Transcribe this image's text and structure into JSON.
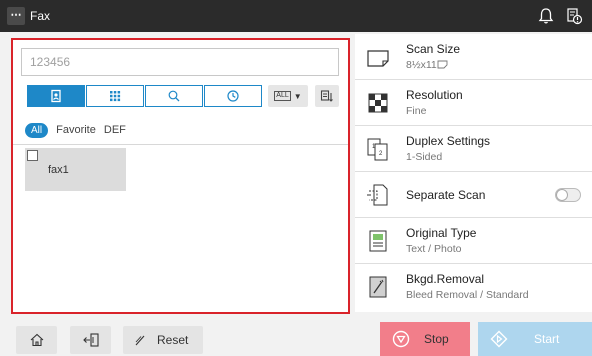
{
  "header": {
    "menu_label": "⋯",
    "title": "Fax"
  },
  "address": {
    "number_value": "123456",
    "dropdown_label": "ALL",
    "filters": [
      "All",
      "Favorite",
      "DEF"
    ],
    "entries": [
      {
        "name": "fax1",
        "checked": false
      }
    ]
  },
  "settings": [
    {
      "label": "Scan Size",
      "value": "8½x11",
      "icon": "scan-size-icon"
    },
    {
      "label": "Resolution",
      "value": "Fine",
      "icon": "resolution-icon"
    },
    {
      "label": "Duplex Settings",
      "value": "1-Sided",
      "icon": "duplex-icon"
    },
    {
      "label": "Separate Scan",
      "value": "",
      "icon": "separate-scan-icon",
      "toggle": false
    },
    {
      "label": "Original Type",
      "value": "Text / Photo",
      "icon": "original-type-icon"
    },
    {
      "label": "Bkgd.Removal",
      "value": "Bleed Removal / Standard",
      "icon": "bkgd-removal-icon"
    }
  ],
  "footer": {
    "reset_label": "Reset",
    "stop_label": "Stop",
    "start_label": "Start"
  },
  "colors": {
    "accent": "#1e88c8",
    "highlight_border": "#d9232a",
    "stop": "#f27e8a",
    "start_disabled": "#aed6ee"
  }
}
